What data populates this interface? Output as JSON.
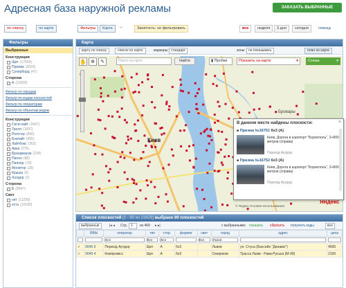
{
  "header": {
    "title": "Адресная база наружной рекламы",
    "order_button": "ЗАКАЗАТЬ ВЫБРАННЫЕ"
  },
  "topbar": {
    "view_tabs": [
      "по списку",
      "по карте"
    ],
    "filter_tabs": [
      "Фильтры",
      "Карта"
    ],
    "occupancy_label": "Занятость:",
    "occupancy_value": "не фильтровать",
    "time_tabs": [
      "все",
      "неделя",
      "3 дня",
      "сегодня"
    ],
    "help": "помощь"
  },
  "sidebar": {
    "title": "Фильтры",
    "selected_label": "Выбранные",
    "construction_label": "Конструкция",
    "constructions": [
      {
        "label": "Щит",
        "count": "(17659)"
      },
      {
        "label": "Призма",
        "count": "(3029)"
      },
      {
        "label": "Суперборд",
        "count": "(47)"
      }
    ],
    "side_label": "Сторона",
    "sides": [
      {
        "label": "А",
        "count": "(13009)"
      }
    ],
    "links": [
      "Фильтр по городам",
      "Фильтр по кодам плоскостей",
      "Фильтр по операторам",
      "Фильтр по объектам рядом"
    ],
    "construction2_label": "Конструкция",
    "constructions2": [
      {
        "label": "Сити-лайт",
        "count": "(3407)"
      },
      {
        "label": "Тролл",
        "count": "(1097)"
      },
      {
        "label": "Ролл-ер",
        "count": "(840)"
      },
      {
        "label": "Бэклайт",
        "count": "(495)"
      },
      {
        "label": "Лайтбокс",
        "count": "(362)"
      },
      {
        "label": "Арка",
        "count": "(276)"
      },
      {
        "label": "Брандмауэр",
        "count": "(104)"
      },
      {
        "label": "Пилон",
        "count": "(88)"
      },
      {
        "label": "Пилпер",
        "count": "(79)"
      },
      {
        "label": "Монитор",
        "count": "(18)"
      },
      {
        "label": "Крыша",
        "count": "(5)"
      },
      {
        "label": "Холдер",
        "count": "(2)"
      }
    ],
    "side2_label": "Сторона",
    "sides2": [
      {
        "label": "Б",
        "count": "(8947)"
      }
    ],
    "light_label": "Свет",
    "lights": [
      {
        "label": "нет",
        "count": "(11236)"
      },
      {
        "label": "есть",
        "count": "(10180)"
      }
    ]
  },
  "map": {
    "title": "Карта",
    "btn_to_list": "карту по списку",
    "btn_list_to_map": "список по карте",
    "layers_label": "маркеры:",
    "layers_value": "стандарт",
    "zones_label": "зоны:",
    "zones_value": "не показывать",
    "plan_button": "план по карте",
    "search_placeholder": "Поиск на карте",
    "find_button": "Найти",
    "traffic": "Пробки",
    "show_on_map": "Показать на карте",
    "scheme": "Схема",
    "city_label": "Киев",
    "brovary_label": "Бровары",
    "copyright": "© Яндекс  Условия использования",
    "logo": "Яндекс",
    "popup": {
      "title": "В данном месте найдены плоскости:",
      "items": [
        {
          "code": "Призма №16751",
          "size": "6x3 (А)",
          "text": "Киев, Дорога в аэропорт \"Борисполь\", 2+800 метров (справа)",
          "operator": "Перехід Аутдор"
        },
        {
          "code": "Призма №16752",
          "size": "6x3 (А)",
          "text": "Киев, Дорога в аэропорт \"Борисполь\", 2+800 метров (справа)",
          "operator": "Перехід Аутдор"
        }
      ]
    }
  },
  "table": {
    "title": "Список плоскостей",
    "range": "[1 - 90 из 23429]",
    "selected": "выбрано 90 плоскостей",
    "view_label": "выбранные",
    "page_label": "Стр.",
    "page_value": "1",
    "page_total": "из 469",
    "with_selected": "с выбранными:",
    "show": "показать",
    "reset": "сбросить",
    "get_codes": "получить коды",
    "all": "все",
    "headers": [
      "",
      "ВВЫ",
      "оператор",
      "тип",
      "стор.",
      "формат",
      "свет",
      "город",
      "адрес",
      "цена"
    ],
    "filters": [
      "",
      "",
      "Все",
      "Все",
      "Все",
      "",
      "Все",
      "Львов",
      "",
      ""
    ],
    "rows": [
      {
        "id": "9045 6",
        "operator": "Перехід Аутдор",
        "type": "Щит",
        "side": "А",
        "format": "6x3",
        "light": "",
        "city": "Львов",
        "address": "ул. Стуса (Бассейн \"Динамо\")",
        "price": "4500"
      },
      {
        "id": "9045 4",
        "operator": "Компромісс",
        "type": "Щит",
        "side": "А",
        "format": "6x3",
        "light": "",
        "city": "Смереков",
        "address": "Трасса Львів - Рава-Руська (М-09)",
        "price": "2100"
      }
    ]
  },
  "colors": {
    "accent": "#2a5d8f",
    "marker": "#c8102e",
    "order_green": "#3d9a3d"
  }
}
